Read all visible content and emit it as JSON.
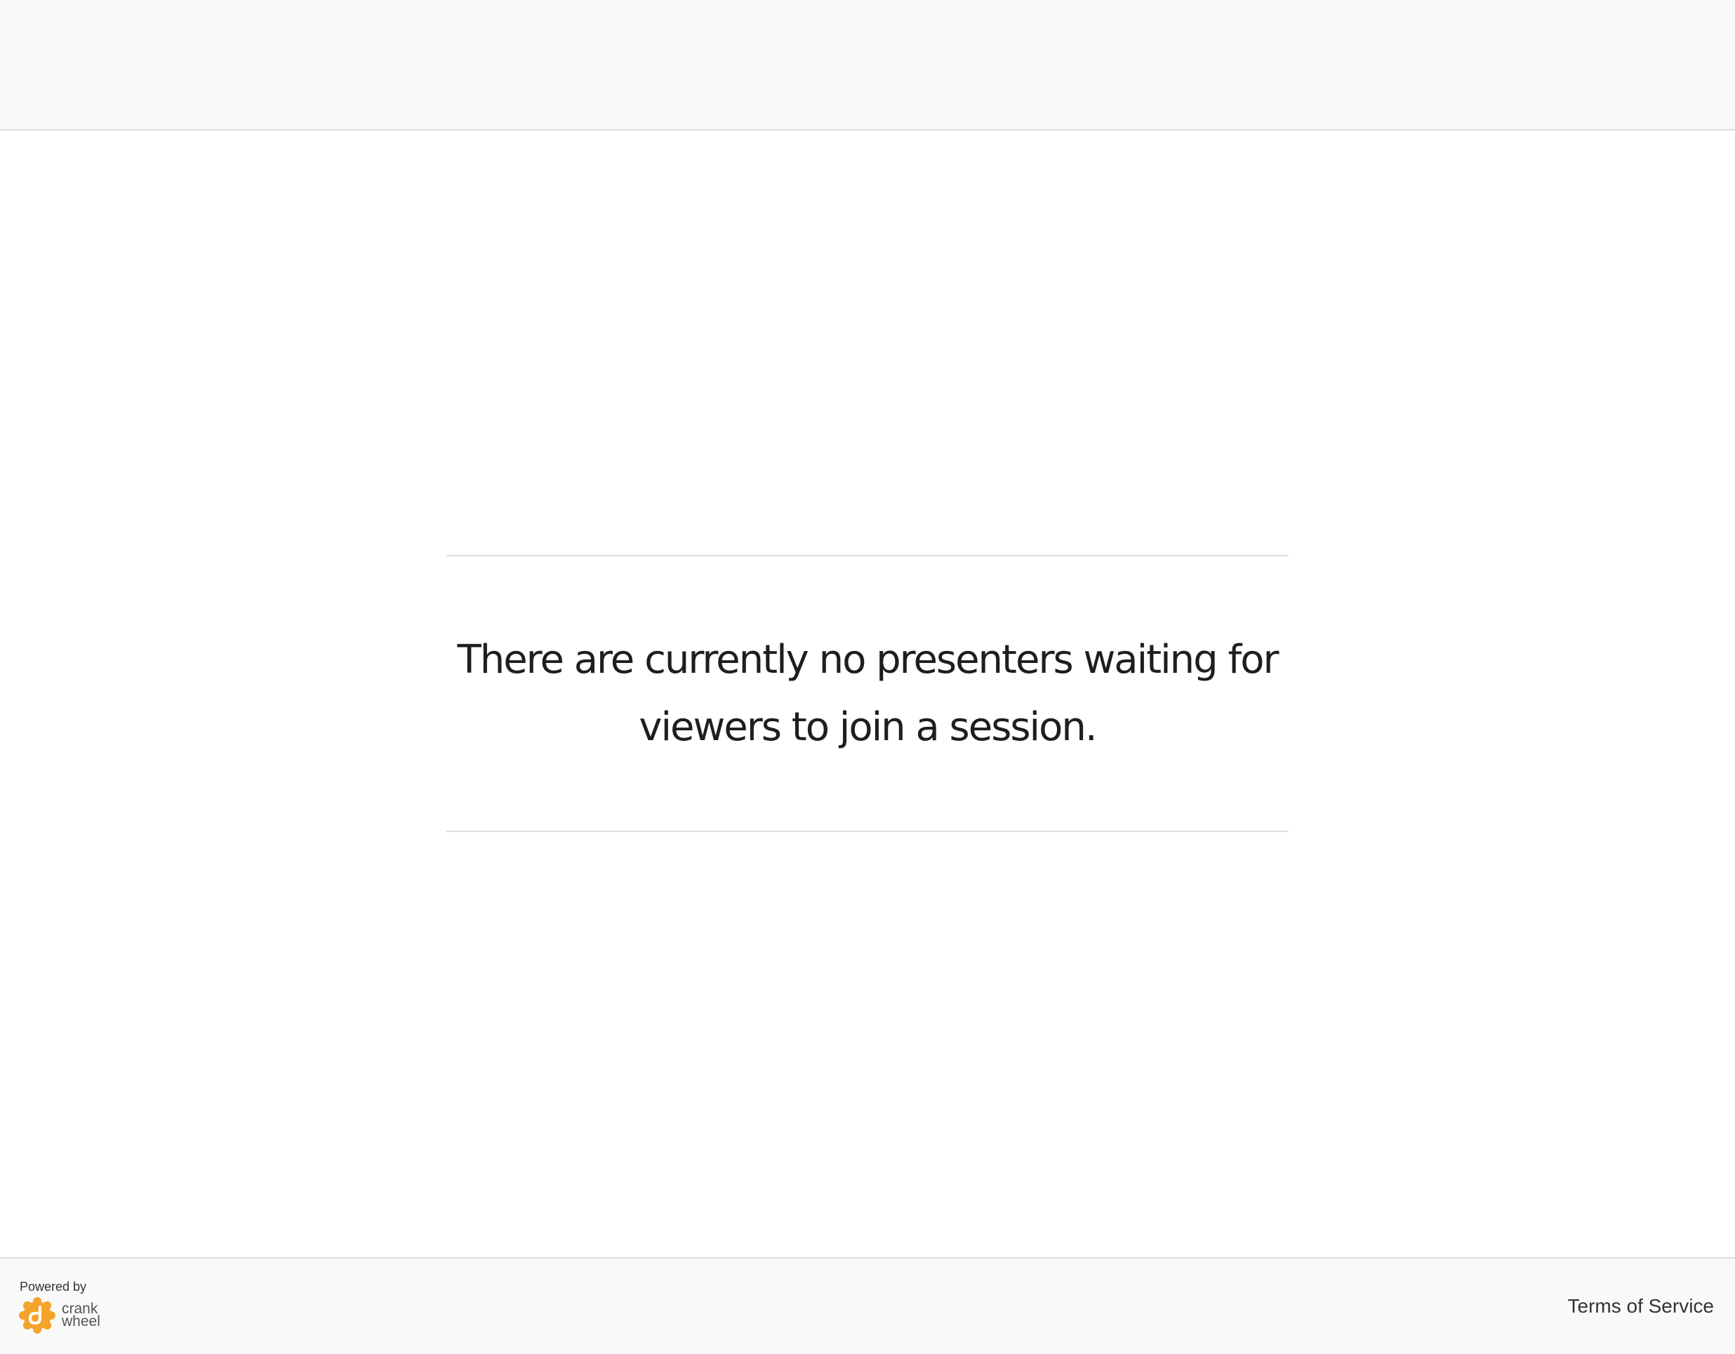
{
  "message": {
    "text": "There are currently no presenters waiting for viewers to join a session."
  },
  "footer": {
    "powered_by": "Powered by",
    "brand_line1": "crank",
    "brand_line2": "wheel",
    "brand_icon": "crankwheel-logo-icon",
    "brand_color": "#F5A42A",
    "terms_label": "Terms of Service"
  },
  "colors": {
    "header_background": "#F9F9F9",
    "footer_background": "#F9F9F9",
    "text": "#1E1E1E"
  }
}
